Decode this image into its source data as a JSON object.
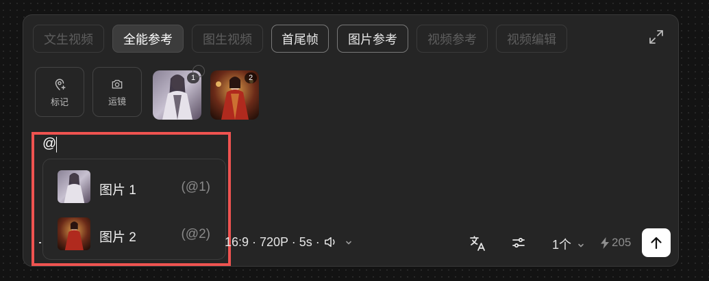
{
  "tabs": [
    {
      "label": "文生视频",
      "state": "disabled"
    },
    {
      "label": "全能参考",
      "state": "active"
    },
    {
      "label": "图生视频",
      "state": "disabled"
    },
    {
      "label": "首尾帧",
      "state": "enabled"
    },
    {
      "label": "图片参考",
      "state": "enabled"
    },
    {
      "label": "视频参考",
      "state": "disabled"
    },
    {
      "label": "视频编辑",
      "state": "disabled"
    }
  ],
  "tools": [
    {
      "label": "标记",
      "icon": "location-pin-plus-icon"
    },
    {
      "label": "运镜",
      "icon": "camera-icon"
    }
  ],
  "thumbnails": [
    {
      "badge": "1"
    },
    {
      "badge": "2"
    }
  ],
  "prompt": {
    "value": "@"
  },
  "mention_dropdown": {
    "options": [
      {
        "label": "图片 1",
        "hint": "(@1)"
      },
      {
        "label": "图片 2",
        "hint": "(@2)"
      }
    ]
  },
  "footer": {
    "settings_text": "16:9 · 720P · 5s ·",
    "count_label": "1个",
    "credits": "205"
  },
  "colors": {
    "panel": "#252525",
    "highlight": "#ef5350",
    "send_button": "#ffffff"
  }
}
